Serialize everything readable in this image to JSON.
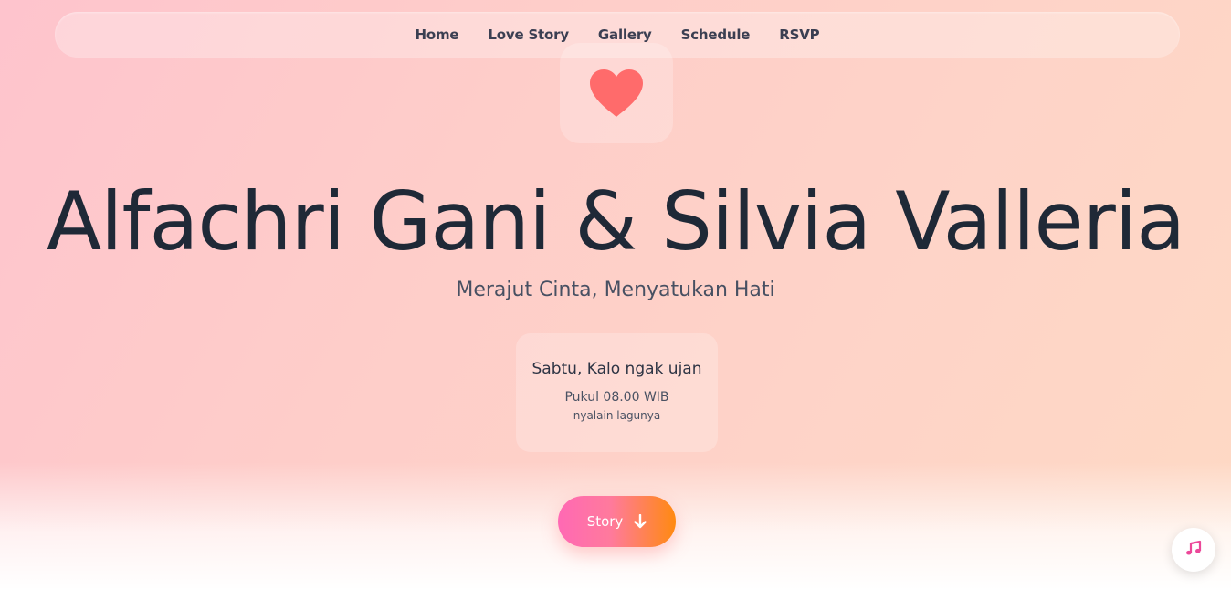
{
  "nav": {
    "items": [
      {
        "label": "Home"
      },
      {
        "label": "Love Story"
      },
      {
        "label": "Gallery"
      },
      {
        "label": "Schedule"
      },
      {
        "label": "RSVP"
      }
    ]
  },
  "hero": {
    "icon": "heart-icon",
    "names": "Alfachri Gani & Silvia Valleria",
    "tagline": "Merajut Cinta, Menyatukan Hati"
  },
  "event": {
    "day": "Sabtu, Kalo ngak ujan",
    "time": "Pukul 08.00 WIB",
    "note": "nyalain lagunya"
  },
  "story_button": {
    "label": "Story",
    "icon": "arrow-down-icon"
  },
  "music_button": {
    "icon": "music-note-icon"
  },
  "colors": {
    "heart": "#ff6b6b",
    "music_icon": "#ec4899",
    "button_gradient_start": "#ff69b4",
    "button_gradient_end": "#ff8a10",
    "text_dark": "#1f2937"
  }
}
